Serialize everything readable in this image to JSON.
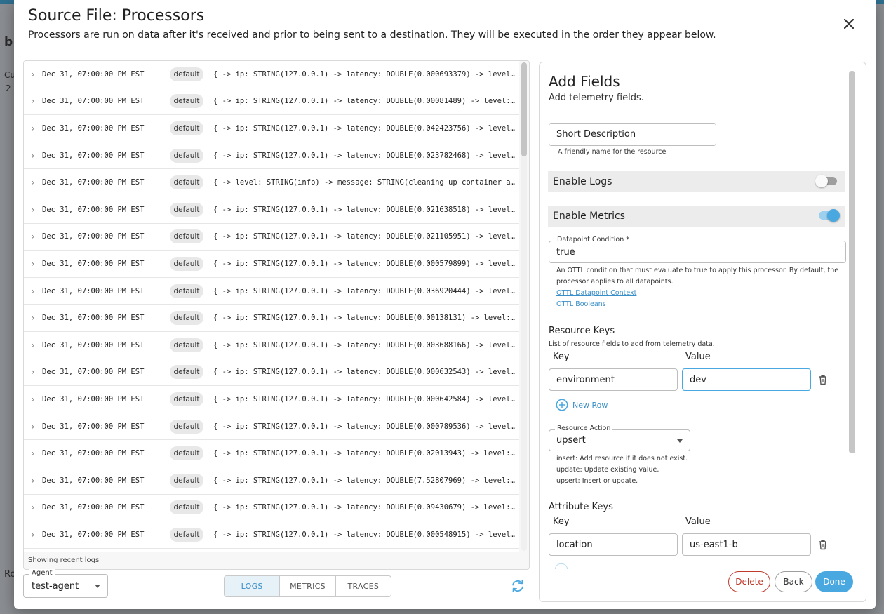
{
  "modal": {
    "title": "Source File: Processors",
    "subtitle": "Processors are run on data after it's received and prior to being sent to a destination. They will be executed in the order they appear below.",
    "close_icon": "close-icon"
  },
  "logs": {
    "rows": [
      {
        "timestamp": "Dec 31, 07:00:00 PM EST",
        "badge": "default",
        "message": "{ -> ip: STRING(127.0.0.1) -> latency: DOUBLE(0.000693379) -> level: STRING(info)"
      },
      {
        "timestamp": "Dec 31, 07:00:00 PM EST",
        "badge": "default",
        "message": "{ -> ip: STRING(127.0.0.1) -> latency: DOUBLE(0.00081489) -> level: STRING(info)"
      },
      {
        "timestamp": "Dec 31, 07:00:00 PM EST",
        "badge": "default",
        "message": "{ -> ip: STRING(127.0.0.1) -> latency: DOUBLE(0.042423756) -> level: STRING(info)"
      },
      {
        "timestamp": "Dec 31, 07:00:00 PM EST",
        "badge": "default",
        "message": "{ -> ip: STRING(127.0.0.1) -> latency: DOUBLE(0.023782468) -> level: STRING(info)"
      },
      {
        "timestamp": "Dec 31, 07:00:00 PM EST",
        "badge": "default",
        "message": "{ -> level: STRING(info) -> message: STRING(cleaning up container agents d"
      },
      {
        "timestamp": "Dec 31, 07:00:00 PM EST",
        "badge": "default",
        "message": "{ -> ip: STRING(127.0.0.1) -> latency: DOUBLE(0.021638518) -> level: STRING(info)"
      },
      {
        "timestamp": "Dec 31, 07:00:00 PM EST",
        "badge": "default",
        "message": "{ -> ip: STRING(127.0.0.1) -> latency: DOUBLE(0.021105951) -> level: STRING(info)"
      },
      {
        "timestamp": "Dec 31, 07:00:00 PM EST",
        "badge": "default",
        "message": "{ -> ip: STRING(127.0.0.1) -> latency: DOUBLE(0.000579899) -> level: STRING(info)"
      },
      {
        "timestamp": "Dec 31, 07:00:00 PM EST",
        "badge": "default",
        "message": "{ -> ip: STRING(127.0.0.1) -> latency: DOUBLE(0.036920444) -> level: STRING(info)"
      },
      {
        "timestamp": "Dec 31, 07:00:00 PM EST",
        "badge": "default",
        "message": "{ -> ip: STRING(127.0.0.1) -> latency: DOUBLE(0.00138131) -> level: STRING(info)"
      },
      {
        "timestamp": "Dec 31, 07:00:00 PM EST",
        "badge": "default",
        "message": "{ -> ip: STRING(127.0.0.1) -> latency: DOUBLE(0.003688166) -> level: STRING(info)"
      },
      {
        "timestamp": "Dec 31, 07:00:00 PM EST",
        "badge": "default",
        "message": "{ -> ip: STRING(127.0.0.1) -> latency: DOUBLE(0.000632543) -> level: STRING(info)"
      },
      {
        "timestamp": "Dec 31, 07:00:00 PM EST",
        "badge": "default",
        "message": "{ -> ip: STRING(127.0.0.1) -> latency: DOUBLE(0.000642584) -> level: STRING(info)"
      },
      {
        "timestamp": "Dec 31, 07:00:00 PM EST",
        "badge": "default",
        "message": "{ -> ip: STRING(127.0.0.1) -> latency: DOUBLE(0.000789536) -> level: STRING(info)"
      },
      {
        "timestamp": "Dec 31, 07:00:00 PM EST",
        "badge": "default",
        "message": "{ -> ip: STRING(127.0.0.1) -> latency: DOUBLE(0.02013943) -> level: STRING(info)"
      },
      {
        "timestamp": "Dec 31, 07:00:00 PM EST",
        "badge": "default",
        "message": "{ -> ip: STRING(127.0.0.1) -> latency: DOUBLE(7.52807969) -> level: STRING(info)"
      },
      {
        "timestamp": "Dec 31, 07:00:00 PM EST",
        "badge": "default",
        "message": "{ -> ip: STRING(127.0.0.1) -> latency: DOUBLE(0.09430679) -> level: STRING(info)"
      },
      {
        "timestamp": "Dec 31, 07:00:00 PM EST",
        "badge": "default",
        "message": "{ -> ip: STRING(127.0.0.1) -> latency: DOUBLE(0.000548915) -> level: STRING(info)"
      }
    ],
    "footer": "Showing recent logs"
  },
  "controls": {
    "agent_label": "Agent",
    "agent_value": "test-agent",
    "tabs": [
      {
        "label": "LOGS",
        "active": true
      },
      {
        "label": "METRICS",
        "active": false
      },
      {
        "label": "TRACES",
        "active": false
      }
    ],
    "refresh_icon": "refresh-icon"
  },
  "config": {
    "title": "Add Fields",
    "subtitle": "Add telemetry fields.",
    "short_description": {
      "value": "Short Description",
      "helper": "A friendly name for the resource"
    },
    "enable_logs": {
      "label": "Enable Logs",
      "enabled": false
    },
    "enable_metrics": {
      "label": "Enable Metrics",
      "enabled": true
    },
    "datapoint_condition": {
      "label": "Datapoint Condition *",
      "value": "true",
      "helper_line1": "An OTTL condition that must evaluate to true to apply this processor. By default, the",
      "helper_line2": "processor applies to all datapoints.",
      "link1": "OTTL Datapoint Context",
      "link2": "OTTL Booleans"
    },
    "resource_keys": {
      "title": "Resource Keys",
      "helper": "List of resource fields to add from telemetry data.",
      "key_header": "Key",
      "value_header": "Value",
      "rows": [
        {
          "key": "environment",
          "value": "dev"
        }
      ],
      "new_row_label": "New Row"
    },
    "resource_action": {
      "label": "Resource Action",
      "value": "upsert",
      "help1": "insert: Add resource if it does not exist.",
      "help2": "update: Update existing value.",
      "help3": "upsert: Insert or update."
    },
    "attribute_keys": {
      "title": "Attribute Keys",
      "key_header": "Key",
      "value_header": "Value",
      "rows": [
        {
          "key": "location",
          "value": "us-east1-b"
        }
      ]
    },
    "buttons": {
      "delete": "Delete",
      "back": "Back",
      "done": "Done"
    },
    "colors": {
      "accent": "#4aa8e0",
      "danger": "#c0392b",
      "toggle_off": "#9e9e9e"
    }
  },
  "background": {
    "frag_b": "b",
    "frag_cu": "Cu",
    "frag_2": "2",
    "frag_ro": "Ro"
  }
}
